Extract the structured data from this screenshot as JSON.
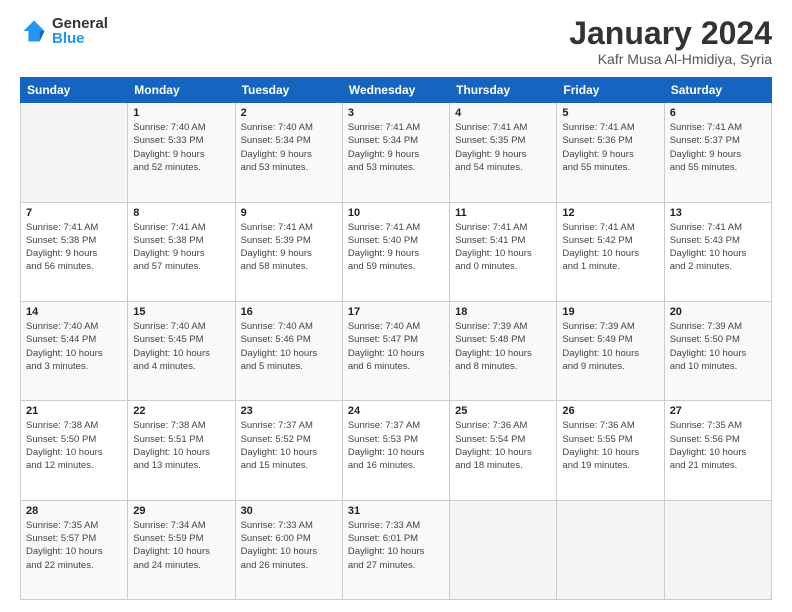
{
  "logo": {
    "text_general": "General",
    "text_blue": "Blue"
  },
  "title": "January 2024",
  "subtitle": "Kafr Musa Al-Hmidiya, Syria",
  "days_header": [
    "Sunday",
    "Monday",
    "Tuesday",
    "Wednesday",
    "Thursday",
    "Friday",
    "Saturday"
  ],
  "weeks": [
    [
      {
        "num": "",
        "info": ""
      },
      {
        "num": "1",
        "info": "Sunrise: 7:40 AM\nSunset: 5:33 PM\nDaylight: 9 hours\nand 52 minutes."
      },
      {
        "num": "2",
        "info": "Sunrise: 7:40 AM\nSunset: 5:34 PM\nDaylight: 9 hours\nand 53 minutes."
      },
      {
        "num": "3",
        "info": "Sunrise: 7:41 AM\nSunset: 5:34 PM\nDaylight: 9 hours\nand 53 minutes."
      },
      {
        "num": "4",
        "info": "Sunrise: 7:41 AM\nSunset: 5:35 PM\nDaylight: 9 hours\nand 54 minutes."
      },
      {
        "num": "5",
        "info": "Sunrise: 7:41 AM\nSunset: 5:36 PM\nDaylight: 9 hours\nand 55 minutes."
      },
      {
        "num": "6",
        "info": "Sunrise: 7:41 AM\nSunset: 5:37 PM\nDaylight: 9 hours\nand 55 minutes."
      }
    ],
    [
      {
        "num": "7",
        "info": "Sunrise: 7:41 AM\nSunset: 5:38 PM\nDaylight: 9 hours\nand 56 minutes."
      },
      {
        "num": "8",
        "info": "Sunrise: 7:41 AM\nSunset: 5:38 PM\nDaylight: 9 hours\nand 57 minutes."
      },
      {
        "num": "9",
        "info": "Sunrise: 7:41 AM\nSunset: 5:39 PM\nDaylight: 9 hours\nand 58 minutes."
      },
      {
        "num": "10",
        "info": "Sunrise: 7:41 AM\nSunset: 5:40 PM\nDaylight: 9 hours\nand 59 minutes."
      },
      {
        "num": "11",
        "info": "Sunrise: 7:41 AM\nSunset: 5:41 PM\nDaylight: 10 hours\nand 0 minutes."
      },
      {
        "num": "12",
        "info": "Sunrise: 7:41 AM\nSunset: 5:42 PM\nDaylight: 10 hours\nand 1 minute."
      },
      {
        "num": "13",
        "info": "Sunrise: 7:41 AM\nSunset: 5:43 PM\nDaylight: 10 hours\nand 2 minutes."
      }
    ],
    [
      {
        "num": "14",
        "info": "Sunrise: 7:40 AM\nSunset: 5:44 PM\nDaylight: 10 hours\nand 3 minutes."
      },
      {
        "num": "15",
        "info": "Sunrise: 7:40 AM\nSunset: 5:45 PM\nDaylight: 10 hours\nand 4 minutes."
      },
      {
        "num": "16",
        "info": "Sunrise: 7:40 AM\nSunset: 5:46 PM\nDaylight: 10 hours\nand 5 minutes."
      },
      {
        "num": "17",
        "info": "Sunrise: 7:40 AM\nSunset: 5:47 PM\nDaylight: 10 hours\nand 6 minutes."
      },
      {
        "num": "18",
        "info": "Sunrise: 7:39 AM\nSunset: 5:48 PM\nDaylight: 10 hours\nand 8 minutes."
      },
      {
        "num": "19",
        "info": "Sunrise: 7:39 AM\nSunset: 5:49 PM\nDaylight: 10 hours\nand 9 minutes."
      },
      {
        "num": "20",
        "info": "Sunrise: 7:39 AM\nSunset: 5:50 PM\nDaylight: 10 hours\nand 10 minutes."
      }
    ],
    [
      {
        "num": "21",
        "info": "Sunrise: 7:38 AM\nSunset: 5:50 PM\nDaylight: 10 hours\nand 12 minutes."
      },
      {
        "num": "22",
        "info": "Sunrise: 7:38 AM\nSunset: 5:51 PM\nDaylight: 10 hours\nand 13 minutes."
      },
      {
        "num": "23",
        "info": "Sunrise: 7:37 AM\nSunset: 5:52 PM\nDaylight: 10 hours\nand 15 minutes."
      },
      {
        "num": "24",
        "info": "Sunrise: 7:37 AM\nSunset: 5:53 PM\nDaylight: 10 hours\nand 16 minutes."
      },
      {
        "num": "25",
        "info": "Sunrise: 7:36 AM\nSunset: 5:54 PM\nDaylight: 10 hours\nand 18 minutes."
      },
      {
        "num": "26",
        "info": "Sunrise: 7:36 AM\nSunset: 5:55 PM\nDaylight: 10 hours\nand 19 minutes."
      },
      {
        "num": "27",
        "info": "Sunrise: 7:35 AM\nSunset: 5:56 PM\nDaylight: 10 hours\nand 21 minutes."
      }
    ],
    [
      {
        "num": "28",
        "info": "Sunrise: 7:35 AM\nSunset: 5:57 PM\nDaylight: 10 hours\nand 22 minutes."
      },
      {
        "num": "29",
        "info": "Sunrise: 7:34 AM\nSunset: 5:59 PM\nDaylight: 10 hours\nand 24 minutes."
      },
      {
        "num": "30",
        "info": "Sunrise: 7:33 AM\nSunset: 6:00 PM\nDaylight: 10 hours\nand 26 minutes."
      },
      {
        "num": "31",
        "info": "Sunrise: 7:33 AM\nSunset: 6:01 PM\nDaylight: 10 hours\nand 27 minutes."
      },
      {
        "num": "",
        "info": ""
      },
      {
        "num": "",
        "info": ""
      },
      {
        "num": "",
        "info": ""
      }
    ]
  ]
}
